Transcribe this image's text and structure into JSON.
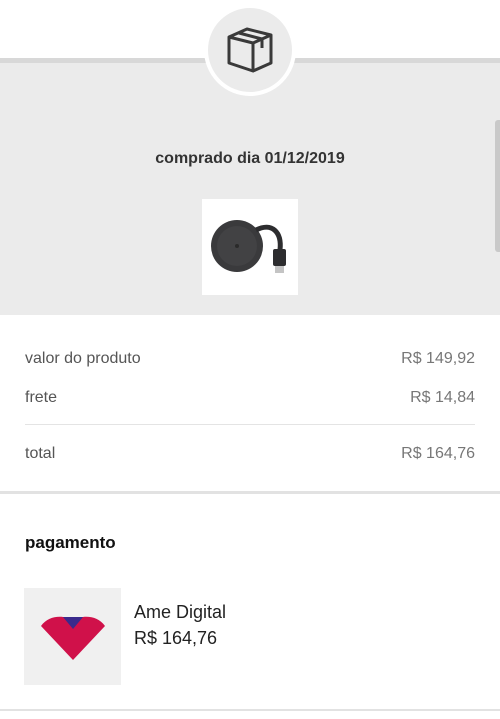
{
  "header": {
    "icon": "package-box-icon",
    "purchase_date": "comprado dia 01/12/2019",
    "product_image": "chromecast-device-image"
  },
  "summary": {
    "product_value_label": "valor do produto",
    "product_value": "R$ 149,92",
    "shipping_label": "frete",
    "shipping_value": "R$ 14,84",
    "total_label": "total",
    "total_value": "R$ 164,76"
  },
  "payment": {
    "title": "pagamento",
    "method_name": "Ame Digital",
    "method_amount": "R$ 164,76",
    "logo": "ame-digital-logo",
    "brand_colors": {
      "primary": "#d0114a",
      "secondary": "#3a2a8c"
    }
  },
  "colors": {
    "panel_bg": "#ebebeb",
    "text": "#333333"
  }
}
